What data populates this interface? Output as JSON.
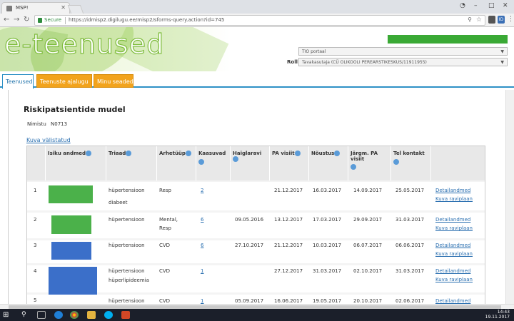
{
  "browser": {
    "tab_title": "MSP!",
    "secure_label": "Secure",
    "url": "https://idmisp2.digilugu.ee/misp2/sforms-query.action?id=745",
    "win_min": "–",
    "win_max": "□",
    "win_close": "✕"
  },
  "header": {
    "logo": "e-teenused",
    "portal_select": "TIO portaal",
    "role_label": "Roll",
    "role_select": "Tavakasutaja (CÜ OLIKOOLI PEREARSTIKESKUS/11911955)"
  },
  "tabs": [
    {
      "label": "Teenused"
    },
    {
      "label": "Teenuste ajalugu"
    },
    {
      "label": "Minu seaded"
    }
  ],
  "main": {
    "title": "Riskipatsientide mudel",
    "name_label": "Nimistu",
    "name_value": "N0713",
    "view_link": "Kuva välistatud"
  },
  "table": {
    "headers": [
      "",
      "Isiku andmed",
      "Triaad",
      "Arhetüüp",
      "Kaasuvad",
      "Haiglaravi",
      "PA visiit",
      "Nõustus",
      "Järgm. PA visiit",
      "Tel kontakt",
      ""
    ],
    "rows": [
      {
        "n": "1",
        "triad": "hüpertensioon",
        "triad2": "diabeet",
        "arch": "Resp",
        "arch2": "",
        "kaas": "2",
        "haigla": "",
        "pa": "21.12.2017",
        "noustus": "16.03.2017",
        "jargm": "14.09.2017",
        "tel": "25.05.2017"
      },
      {
        "n": "2",
        "triad": "hüpertensioon",
        "triad2": "",
        "arch": "Mental,",
        "arch2": "Resp",
        "kaas": "6",
        "haigla": "09.05.2016",
        "pa": "13.12.2017",
        "noustus": "17.03.2017",
        "jargm": "29.09.2017",
        "tel": "31.03.2017"
      },
      {
        "n": "3",
        "triad": "hüpertensioon",
        "triad2": "",
        "arch": "CVD",
        "arch2": "",
        "kaas": "6",
        "haigla": "27.10.2017",
        "pa": "21.12.2017",
        "noustus": "10.03.2017",
        "jargm": "06.07.2017",
        "tel": "06.06.2017"
      },
      {
        "n": "4",
        "triad": "hüpertensioon",
        "triad2": "hüperlipideemia",
        "arch": "CVD",
        "arch2": "",
        "kaas": "1",
        "haigla": "",
        "pa": "27.12.2017",
        "noustus": "31.03.2017",
        "jargm": "02.10.2017",
        "tel": "31.03.2017"
      },
      {
        "n": "5",
        "triad": "hüpertensioon",
        "triad2": "",
        "arch": "CVD",
        "arch2": "",
        "kaas": "1",
        "haigla": "05.09.2017",
        "pa": "16.06.2017",
        "noustus": "19.05.2017",
        "jargm": "20.10.2017",
        "tel": "02.06.2017"
      }
    ],
    "detail_link": "Detailandmed",
    "plan_link": "Kuva raviplaan"
  },
  "taskbar": {
    "time": "14:43",
    "date": "19.11.2017"
  },
  "colors": {
    "accent_blue": "#2e91c6",
    "tab_orange": "#f2a31c",
    "status_green": "#3aa935",
    "redact_green": "#4bb14a",
    "redact_blue": "#3b6fc9"
  }
}
